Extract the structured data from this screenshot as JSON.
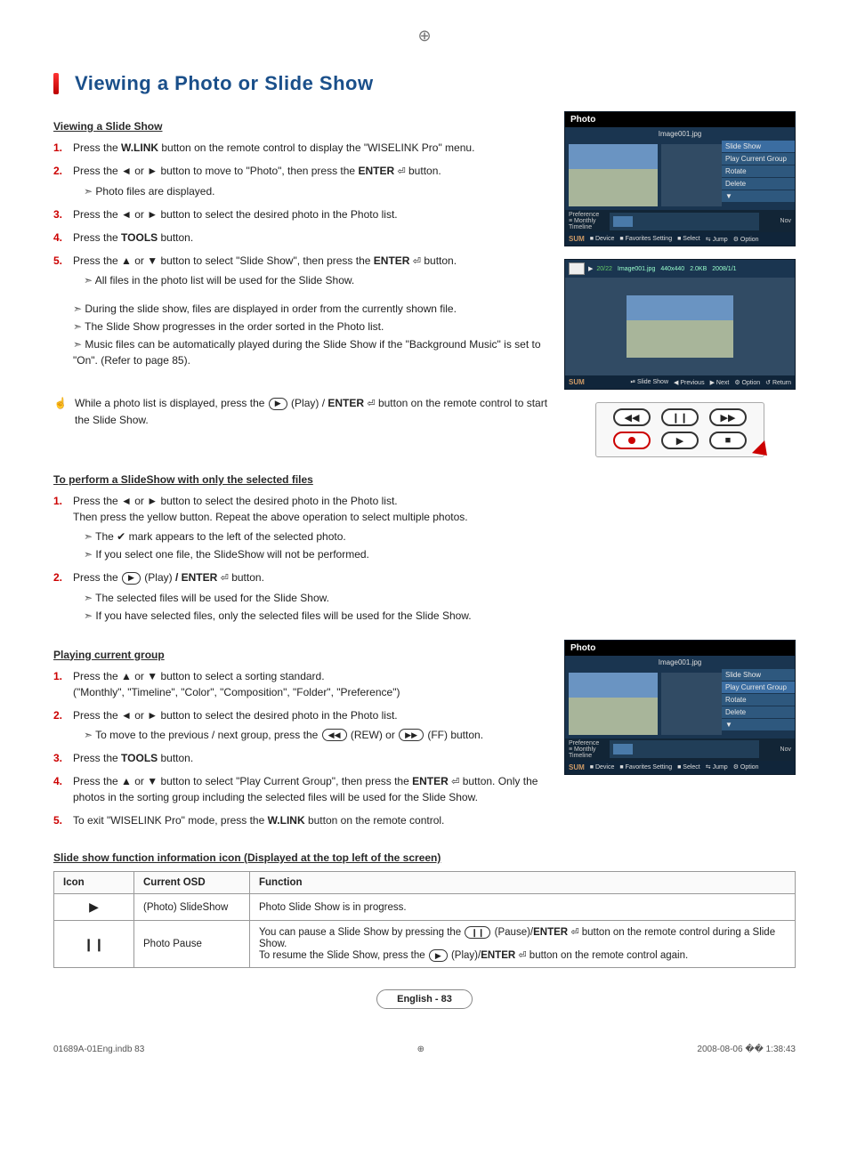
{
  "page": {
    "title": "Viewing a Photo or Slide Show",
    "footer_lang": "English - 83",
    "print_left": "01689A-01Eng.indb   83",
    "print_right": "2008-08-06   �� 1:38:43"
  },
  "sec1": {
    "heading": "Viewing a Slide Show",
    "s1_pre": "Press the ",
    "s1_b1": "W.LINK",
    "s1_post": " button on the remote control to display the \"WISELINK Pro\" menu.",
    "s2_a": "Press the ◄ or ► button to move to \"Photo\", then press the ",
    "s2_b": "ENTER",
    "s2_c": " button.",
    "s2_sub1": "Photo files are displayed.",
    "s3": "Press the ◄ or ► button to select the desired photo in the Photo list.",
    "s4_a": "Press the ",
    "s4_b": "TOOLS",
    "s4_c": " button.",
    "s5_a": "Press the ▲ or ▼ button to select \"Slide Show\", then press the ",
    "s5_b": "ENTER",
    "s5_c": " button.",
    "s5_sub1": "All files in the photo list will be used for the Slide Show.",
    "n1": "During the slide show, files are displayed in order from the currently shown file.",
    "n2": "The Slide Show progresses in the order sorted in the Photo list.",
    "n3": "Music files can be automatically played during the Slide Show if the \"Background Music\" is set to \"On\". (Refer to page 85).",
    "hand_a": "While a photo list is displayed, press the ",
    "hand_b": " (Play) / ",
    "hand_c": "ENTER",
    "hand_d": " button on the remote control to start the Slide Show."
  },
  "sec2": {
    "heading": "To perform a SlideShow with only the selected files",
    "s1a": "Press the ◄ or ► button to select the desired photo in the Photo list.",
    "s1b": "Then press the yellow button. Repeat the above operation to select multiple photos.",
    "s1_sub1": "The ✔ mark appears to the left of the selected photo.",
    "s1_sub2": "If you select one file, the SlideShow will not be performed.",
    "s2_a": "Press the ",
    "s2_b": " (Play) ",
    "s2_c": "/ ENTER",
    "s2_d": " button.",
    "s2_sub1": "The selected files will be used for the Slide Show.",
    "s2_sub2": "If you have selected files, only the selected files will be used for the Slide Show."
  },
  "sec3": {
    "heading": "Playing current group",
    "s1a": "Press the ▲ or ▼ button to select a sorting standard.",
    "s1b": "(\"Monthly\", \"Timeline\", \"Color\", \"Composition\", \"Folder\", \"Preference\")",
    "s2": "Press the ◄ or ► button to select the desired photo in the Photo list.",
    "s2_sub_a": "To move to the previous / next group, press the ",
    "s2_sub_b": " (REW) or ",
    "s2_sub_c": " (FF) button.",
    "s3_a": "Press the ",
    "s3_b": "TOOLS",
    "s3_c": " button.",
    "s4_a": "Press the ▲ or ▼ button to select \"Play Current Group\", then press the ",
    "s4_b": "ENTER",
    "s4_c": " button. Only the photos in the sorting group including the selected files will be used for the Slide Show.",
    "s5_a": "To exit \"WISELINK Pro\" mode, press the ",
    "s5_b": "W.LINK",
    "s5_c": " button on the remote control."
  },
  "sec4": {
    "heading": "Slide show function information icon (Displayed at the top left of the screen)",
    "th1": "Icon",
    "th2": "Current OSD",
    "th3": "Function",
    "r1_icon": "▶",
    "r1_osd": "(Photo) SlideShow",
    "r1_fn": "Photo Slide Show is in progress.",
    "r2_icon": "❙❙",
    "r2_osd": "Photo Pause",
    "r2_fn_a": "You can pause a Slide Show by pressing the ",
    "r2_fn_b": " (Pause)/",
    "r2_fn_c": "ENTER",
    "r2_fn_d": " button on the remote control during a Slide Show.",
    "r2_fn_e": "To resume the Slide Show, press the ",
    "r2_fn_f": " (Play)/",
    "r2_fn_g": "ENTER",
    "r2_fn_h": " button on the remote control again."
  },
  "osd": {
    "photo_title": "Photo",
    "filename": "Image001.jpg",
    "menu": [
      "Slide Show",
      "Play Current Group",
      "Rotate",
      "Delete"
    ],
    "pref": "Preference",
    "sort": "Monthly",
    "timeline": "Timeline",
    "nov": "Nov",
    "sum": "SUM",
    "foot_items": [
      "Device",
      "Favorites Setting",
      "Select",
      "Jump",
      "Option"
    ],
    "ss_counter": "20/22",
    "ss_name": "Image001.jpg",
    "ss_res": "440x440",
    "ss_size": "2.0KB",
    "ss_date": "2008/1/1",
    "ss_foot": [
      "Slide Show",
      "Previous",
      "Next",
      "Option",
      "Return"
    ]
  },
  "remote": {
    "rew": "◀◀",
    "pause": "❙❙",
    "ff": "▶▶",
    "play": "▶",
    "stop": "■"
  },
  "glyph": {
    "play": "▶",
    "pause": "❙❙",
    "rew": "◀◀",
    "ff": "▶▶",
    "enter": "⏎"
  }
}
